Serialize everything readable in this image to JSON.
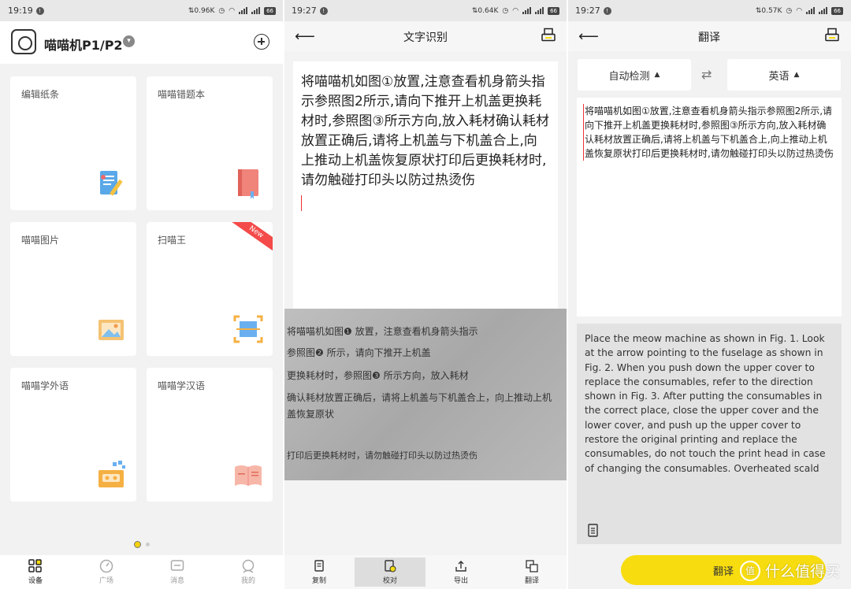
{
  "status_bars": [
    {
      "time": "19:19",
      "speed": "0.96K",
      "battery": "66"
    },
    {
      "time": "19:27",
      "speed": "0.64K",
      "battery": "66"
    },
    {
      "time": "19:27",
      "speed": "0.57K",
      "battery": "66"
    }
  ],
  "home": {
    "device_title": "喵喵机P1/P2",
    "cards": [
      {
        "label": "编辑纸条",
        "illus": "note-edit-illustration"
      },
      {
        "label": "喵喵错题本",
        "illus": "book-illustration"
      },
      {
        "label": "喵喵图片",
        "illus": "photo-illustration"
      },
      {
        "label": "扫喵王",
        "illus": "scan-illustration",
        "badge": "New"
      },
      {
        "label": "喵喵学外语",
        "illus": "cassette-illustration"
      },
      {
        "label": "喵喵学汉语",
        "illus": "chinese-book-illustration"
      }
    ],
    "nav": [
      {
        "label": "设备",
        "icon": "device-grid-icon"
      },
      {
        "label": "广场",
        "icon": "compass-icon"
      },
      {
        "label": "消息",
        "icon": "message-icon"
      },
      {
        "label": "我的",
        "icon": "profile-icon"
      }
    ]
  },
  "ocr": {
    "title": "文字识别",
    "recognized_text": "将喵喵机如图①放置,注意查看机身箭头指示参照图2所示,请向下推开上机盖更换耗材时,参照图③所示方向,放入耗材确认耗材放置正确后,请将上机盖与下机盖合上,向上推动上机盖恢复原状打印后更换耗材时,请勿触碰打印头以防过热烫伤",
    "photo_lines": [
      "将喵喵机如图❶ 放置，注意查看机身箭头指示",
      "参照图❷ 所示，请向下推开上机盖",
      "更换耗材时，参照图❸ 所示方向，放入耗材",
      "确认耗材放置正确后，请将上机盖与下机盖合上，向上推动上机",
      "盖恢复原状",
      "打印后更换耗材时，请勿触碰打印头以防过热烫伤"
    ],
    "tools": [
      {
        "label": "复制",
        "icon": "copy-icon"
      },
      {
        "label": "校对",
        "icon": "proofread-icon"
      },
      {
        "label": "导出",
        "icon": "export-icon"
      },
      {
        "label": "翻译",
        "icon": "translate-icon"
      }
    ]
  },
  "translate": {
    "title": "翻译",
    "source_lang": "自动检测",
    "target_lang": "英语",
    "source_text": "将喵喵机如图①放置,注意查看机身箭头指示参照图2所示,请向下推开上机盖更换耗材时,参照图③所示方向,放入耗材确认耗材放置正确后,请将上机盖与下机盖合上,向上推动上机盖恢复原状打印后更换耗材时,请勿触碰打印头以防过热烫伤",
    "translated_text": "Place the meow machine as shown in Fig. 1. Look at the arrow pointing to the fuselage as shown in Fig. 2. When you push down the upper cover to replace the consumables, refer to the direction shown in Fig. 3. After putting the consumables in the correct place, close the upper cover and the lower cover, and push up the upper cover to restore the original printing and replace the consumables, do not touch the print head in case of changing the consumables. Overheated scald",
    "button_label": "翻译"
  },
  "watermark": {
    "text": "什么值得买",
    "logo_text": "值"
  },
  "colors": {
    "accent": "#f7dc0f",
    "badge": "#f44a4a"
  }
}
